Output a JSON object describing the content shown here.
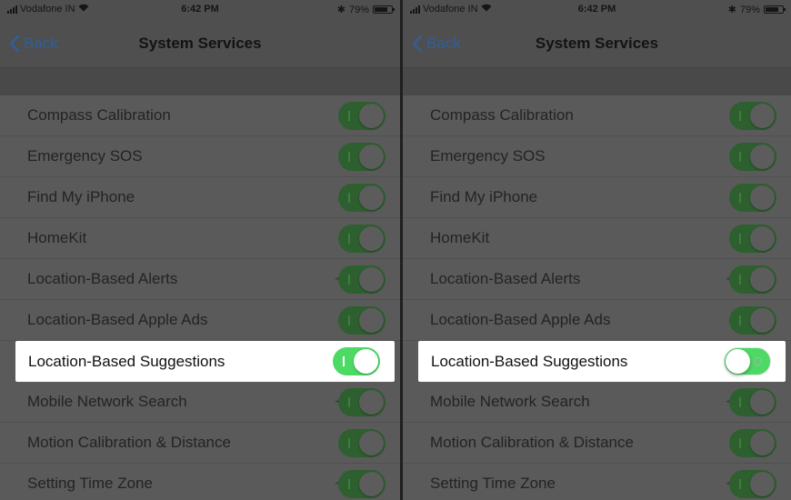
{
  "screens": [
    {
      "status": {
        "carrier": "Vodafone IN",
        "time": "6:42 PM",
        "bluetooth": "✱",
        "battery": "79%"
      },
      "nav": {
        "back": "Back",
        "title": "System Services"
      },
      "rows": [
        {
          "label": "Compass Calibration",
          "arrow": "purple",
          "on": true
        },
        {
          "label": "Emergency SOS",
          "arrow": "none",
          "on": true
        },
        {
          "label": "Find My iPhone",
          "arrow": "none",
          "on": true
        },
        {
          "label": "HomeKit",
          "arrow": "none",
          "on": true
        },
        {
          "label": "Location-Based Alerts",
          "arrow": "gray",
          "on": true
        },
        {
          "label": "Location-Based Apple Ads",
          "arrow": "none",
          "on": true
        },
        {
          "label": "Location-Based Suggestions",
          "arrow": "purple",
          "on": true,
          "highlight": true
        },
        {
          "label": "Mobile Network Search",
          "arrow": "gray",
          "on": true
        },
        {
          "label": "Motion Calibration & Distance",
          "arrow": "none",
          "on": true
        },
        {
          "label": "Setting Time Zone",
          "arrow": "gray",
          "on": true
        }
      ]
    },
    {
      "status": {
        "carrier": "Vodafone IN",
        "time": "6:42 PM",
        "bluetooth": "✱",
        "battery": "79%"
      },
      "nav": {
        "back": "Back",
        "title": "System Services"
      },
      "rows": [
        {
          "label": "Compass Calibration",
          "arrow": "purple",
          "on": true
        },
        {
          "label": "Emergency SOS",
          "arrow": "none",
          "on": true
        },
        {
          "label": "Find My iPhone",
          "arrow": "none",
          "on": true
        },
        {
          "label": "HomeKit",
          "arrow": "none",
          "on": true
        },
        {
          "label": "Location-Based Alerts",
          "arrow": "gray",
          "on": true
        },
        {
          "label": "Location-Based Apple Ads",
          "arrow": "none",
          "on": true
        },
        {
          "label": "Location-Based Suggestions",
          "arrow": "gray",
          "on": false,
          "highlight": true
        },
        {
          "label": "Mobile Network Search",
          "arrow": "gray",
          "on": true
        },
        {
          "label": "Motion Calibration & Distance",
          "arrow": "none",
          "on": true
        },
        {
          "label": "Setting Time Zone",
          "arrow": "gray",
          "on": true
        }
      ]
    }
  ],
  "colors": {
    "toggle_on": "#4cd964",
    "toggle_on_dimmed": "#2d5f2f",
    "arrow_purple": "#a86be0",
    "arrow_purple_dimmed": "#6b4f8a",
    "arrow_gray": "#3a3a3a",
    "arrow_gray_highlight": "#8e8e8e",
    "back_link": "#2f5f9a"
  }
}
